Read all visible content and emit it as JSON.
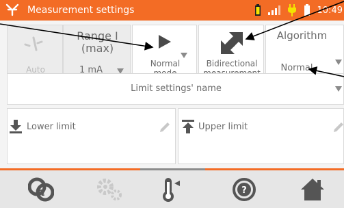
{
  "header": {
    "title": "Measurement settings",
    "time": "10:49",
    "accent": "#f36c25",
    "icons": [
      "instrument-logo-icon",
      "battery-icon",
      "signal-bars-icon",
      "plug-icon",
      "battery-level-icon"
    ]
  },
  "settings": {
    "auto": {
      "label": "Auto",
      "icon": "probe-icon"
    },
    "range": {
      "title_line1": "Range I",
      "title_line2": "(max)",
      "value": "1 mA"
    },
    "mode": {
      "line1": "Normal",
      "line2": "mode",
      "icon": "play-icon"
    },
    "bidirectional": {
      "line1": "Bidirectional",
      "line2": "measurement",
      "icon": "bidirectional-arrows-icon"
    },
    "algorithm": {
      "title": "Algorithm",
      "value": "Normal"
    }
  },
  "limits": {
    "name_label": "Limit settings' name",
    "lower_label": "Lower limit",
    "upper_label": "Upper limit"
  },
  "bottom_nav": {
    "items": [
      "resistance-measurement-icon",
      "settings-gears-icon",
      "thermometer-icon",
      "help-icon",
      "home-icon"
    ]
  }
}
